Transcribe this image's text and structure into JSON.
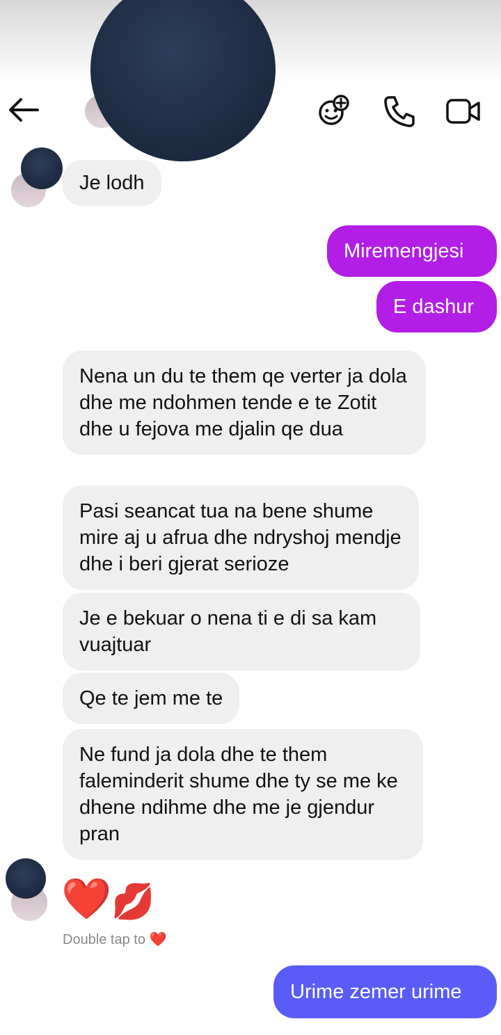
{
  "header": {
    "back_icon": "arrow-left-icon",
    "actions": [
      {
        "icon": "ai-sparkle-icon"
      },
      {
        "icon": "phone-icon"
      },
      {
        "icon": "video-camera-icon"
      }
    ]
  },
  "messages": {
    "m1": "Je lodh",
    "m2": "Miremengjesi",
    "m3": "E dashur",
    "m4": "Nena un du te them qe verter ja dola dhe me ndohmen tende e te Zotit dhe u fejova me djalin qe dua",
    "m5": "Pasi seancat tua na bene shume mire aj u afrua dhe ndryshoj mendje dhe i beri gjerat serioze",
    "m6": "Je e bekuar o nena ti e di sa kam vuajtuar",
    "m7": "Qe te jem me te",
    "m8": "Ne fund ja dola dhe te them faleminderit shume dhe ty se me ke dhene ndihme dhe me je gjendur pran",
    "m9": "Urime zemer urime"
  },
  "reactions": {
    "emojis": [
      "❤️",
      "💋"
    ],
    "double_tap_hint": "Double tap to",
    "hint_icon": "❤️"
  },
  "colors": {
    "sent_purple": "#b21ee6",
    "sent_blue": "#5a5cf7",
    "received_bg": "#efefef"
  }
}
